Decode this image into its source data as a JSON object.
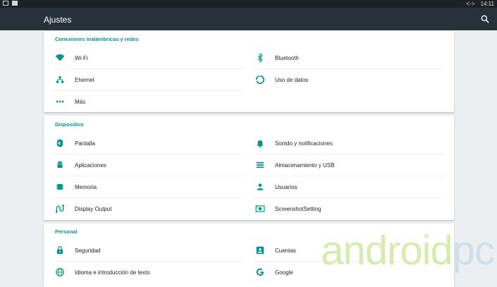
{
  "status_bar": {
    "time": "14:11"
  },
  "app_bar": {
    "title": "Ajustes"
  },
  "sections": {
    "wireless": {
      "title": "Conexiones inalámbricas y redes",
      "items": [
        {
          "label": "Wi-Fi",
          "icon": "wifi-icon"
        },
        {
          "label": "Bluetooth",
          "icon": "bluetooth-icon"
        },
        {
          "label": "Ehernet",
          "icon": "ethernet-icon"
        },
        {
          "label": "Uso de datos",
          "icon": "data-usage-icon"
        },
        {
          "label": "Más",
          "icon": "more-icon"
        }
      ]
    },
    "device": {
      "title": "Dispositivo",
      "items": [
        {
          "label": "Pantalla",
          "icon": "display-icon"
        },
        {
          "label": "Sonido y notificaciones",
          "icon": "bell-icon"
        },
        {
          "label": "Aplicaciones",
          "icon": "android-icon"
        },
        {
          "label": "Almacenamiento y USB",
          "icon": "storage-icon"
        },
        {
          "label": "Memoria",
          "icon": "memory-icon"
        },
        {
          "label": "Usuarios",
          "icon": "user-icon"
        },
        {
          "label": "Display Output",
          "icon": "display-output-icon"
        },
        {
          "label": "ScreenshotSetting",
          "icon": "screenshot-icon"
        }
      ]
    },
    "personal": {
      "title": "Personal",
      "items": [
        {
          "label": "Seguridad",
          "icon": "lock-icon"
        },
        {
          "label": "Cuentas",
          "icon": "account-icon"
        },
        {
          "label": "Idioma e introducción de texto",
          "icon": "globe-icon"
        },
        {
          "label": "Google",
          "icon": "google-icon"
        }
      ]
    }
  },
  "watermark": {
    "main": "android",
    "suffix": "pc"
  },
  "colors": {
    "accent": "#009688",
    "app_bar": "#263238",
    "status_bar": "#1c2327",
    "background": "#eceff1"
  }
}
